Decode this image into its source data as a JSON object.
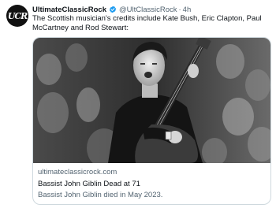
{
  "tweet": {
    "avatar_text": "UCR",
    "author_name": "UltimateClassicRock",
    "handle": "@UltClassicRock",
    "separator": "·",
    "time": "4h",
    "text": "The Scottish musician's credits include Kate Bush, Eric Clapton, Paul McCartney and Rod Stewart:"
  },
  "card": {
    "domain": "ultimateclassicrock.com",
    "title": "Bassist John Giblin Dead at 71",
    "description": "Bassist John Giblin died in May 2023."
  },
  "colors": {
    "verified_badge": "#1d9bf0",
    "secondary_text": "#536471",
    "card_border": "#cfd9de"
  }
}
